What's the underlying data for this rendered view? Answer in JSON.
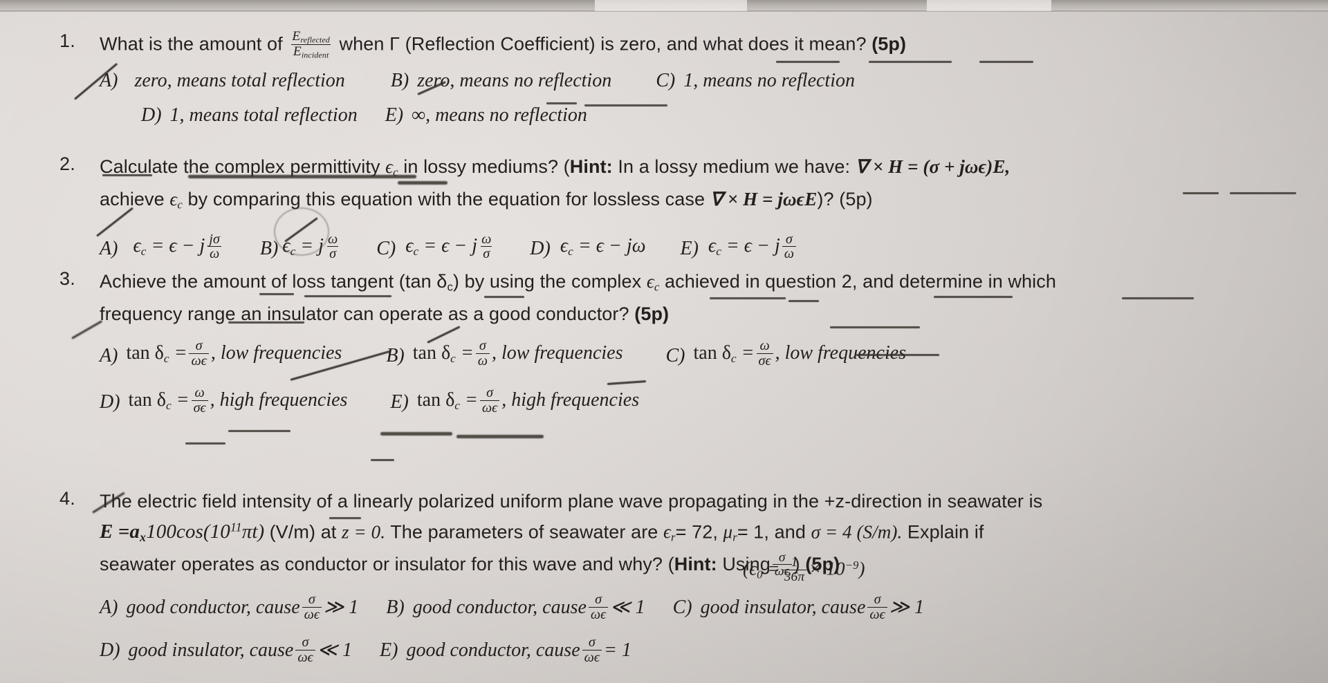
{
  "document": {
    "type": "exam-paper-photograph",
    "paper_color": "#ded9d6",
    "ink_color": "#221f1e",
    "pen_color": "#2b2722"
  },
  "questions": [
    {
      "number": "1.",
      "points": "(5p)",
      "stem_parts": {
        "p1": "What is the amount of",
        "frac_num": "E",
        "frac_num_sub": "reflected",
        "frac_den": "E",
        "frac_den_sub": "incident",
        "p2": "when Γ (Reflection Coefficient) is zero, and what does it mean?",
        "points": "(5p)"
      },
      "options": [
        {
          "label": "A)",
          "text": "zero, means total reflection",
          "struck": true
        },
        {
          "label": "B)",
          "text": "zero, means no reflection",
          "struck": true
        },
        {
          "label": "C)",
          "text": "1,  means no reflection",
          "struck": false
        },
        {
          "label": "D)",
          "text": "1,  means total reflection",
          "struck": false
        },
        {
          "label": "E)",
          "text": "∞,  means no reflection",
          "struck": false
        }
      ]
    },
    {
      "number": "2.",
      "points": "(5p)",
      "stem_parts": {
        "p1": "Calculate the complex permittivity",
        "eps_c": "ϵ",
        "eps_c_sub": "c",
        "p2": "in lossy mediums? (",
        "hint_label": "Hint:",
        "p3": "In a lossy medium we have:",
        "eq1": "∇ × H = (σ + jωϵ)E,",
        "p4": "achieve",
        "p5": "by comparing this equation with the equation for lossless case",
        "eq2": "∇ × H = jωϵE",
        "p6": ")? (5p)"
      },
      "options": [
        {
          "label": "A)",
          "expr": "ϵ_c = ϵ − j (jσ/ω)",
          "num": "jσ",
          "den": "ω",
          "lead": "ϵ",
          "sub": "c",
          "rhs": "= ϵ − j",
          "struck": true
        },
        {
          "label": "B)",
          "expr": "ϵ_c = j (ω/σ)",
          "num": "ω",
          "den": "σ",
          "lead": "ϵ",
          "sub": "c",
          "rhs": "= j",
          "struck": true
        },
        {
          "label": "C)",
          "expr": "ϵ_c = ϵ − j (ω/σ)",
          "num": "ω",
          "den": "σ",
          "lead": "ϵ",
          "sub": "c",
          "rhs": "= ϵ − j",
          "struck": false
        },
        {
          "label": "D)",
          "expr": "ϵ_c = ϵ − jω",
          "num": "",
          "den": "",
          "lead": "ϵ",
          "sub": "c",
          "rhs": "= ϵ − jω",
          "struck": false
        },
        {
          "label": "E)",
          "expr": "ϵ_c = ϵ − j (σ/ω)",
          "num": "σ",
          "den": "ω",
          "lead": "ϵ",
          "sub": "c",
          "rhs": "= ϵ − j",
          "struck": false
        }
      ]
    },
    {
      "number": "3.",
      "points": "(5p)",
      "stem_parts": {
        "p1": "Achieve the amount of loss tangent (tan δ",
        "p1_sub": "c",
        "p2": ")  by using the complex",
        "eps": "ϵ",
        "eps_sub": "c",
        "p3": "achieved in question 2, and determine in which",
        "p4": "frequency range an insulator can operate as a good conductor?",
        "points": "(5p)"
      },
      "options": [
        {
          "label": "A)",
          "lhs": "tan δ",
          "sub": "c",
          "num": "σ",
          "den": "ωϵ",
          "tail": ", low frequencies",
          "struck": true
        },
        {
          "label": "B)",
          "lhs": "tan δ",
          "sub": "c",
          "num": "σ",
          "den": "ω",
          "tail": ", low frequencies",
          "struck": true
        },
        {
          "label": "C)",
          "lhs": "tan δ",
          "sub": "c",
          "num": "ω",
          "den": "σϵ",
          "tail": ", low frequencies",
          "struck": false
        },
        {
          "label": "D)",
          "lhs": "tan δ",
          "sub": "c",
          "num": "ω",
          "den": "σϵ",
          "tail": ", high frequencies",
          "struck": false
        },
        {
          "label": "E)",
          "lhs": "tan δ",
          "sub": "c",
          "num": "σ",
          "den": "ωϵ",
          "tail": ", high frequencies",
          "struck": false
        }
      ]
    },
    {
      "number": "4.",
      "points": "(5p)",
      "stem_parts": {
        "p1": "The electric field intensity of a linearly polarized uniform plane wave propagating in the +z-direction in seawater is",
        "eq_lead": "E =",
        "eq_a": "a",
        "eq_a_sub": "x",
        "eq_mid": "100cos(10",
        "eq_exp": "11",
        "eq_mid2": "πt)",
        "eq_units": "(V/m)",
        "p2": "at",
        "eq_z": "z = 0.",
        "p3": "The parameters of seawater are",
        "eps_r": "ϵ",
        "eps_r_sub": "r",
        "eps_r_val": "= 72,",
        "mu_r": "μ",
        "mu_r_sub": "r",
        "mu_r_val": "= 1, and",
        "sigma_val": "σ = 4 (S/m).",
        "p4": "Explain if",
        "p5": "seawater operates as conductor or insulator for this wave and why? (",
        "hint_label": "Hint:",
        "p6": "Using",
        "hint_num": "σ",
        "hint_den": "ωϵ",
        "p7": ")",
        "points": "(5p)",
        "const_open": "(ϵ",
        "const_sub": "0",
        "const_eq": "=",
        "const_num": "1",
        "const_den": "36π",
        "const_tail": "× 10",
        "const_exp": "−9",
        "const_close": ")"
      },
      "options": [
        {
          "label": "A)",
          "text": "good conductor, cause",
          "num": "σ",
          "den": "ωϵ",
          "rel": "≫ 1",
          "struck": true
        },
        {
          "label": "B)",
          "text": "good conductor, cause",
          "num": "σ",
          "den": "ωϵ",
          "rel": "≪ 1",
          "struck": false
        },
        {
          "label": "C)",
          "text": "good insulator,  cause",
          "num": "σ",
          "den": "ωϵ",
          "rel": "≫ 1",
          "struck": false
        },
        {
          "label": "D)",
          "text": "good insulator,  cause",
          "num": "σ",
          "den": "ωϵ",
          "rel": "≪ 1",
          "struck": false
        },
        {
          "label": "E)",
          "text": "good conductor, cause",
          "num": "σ",
          "den": "ωϵ",
          "rel": "= 1",
          "struck": false
        }
      ]
    }
  ]
}
